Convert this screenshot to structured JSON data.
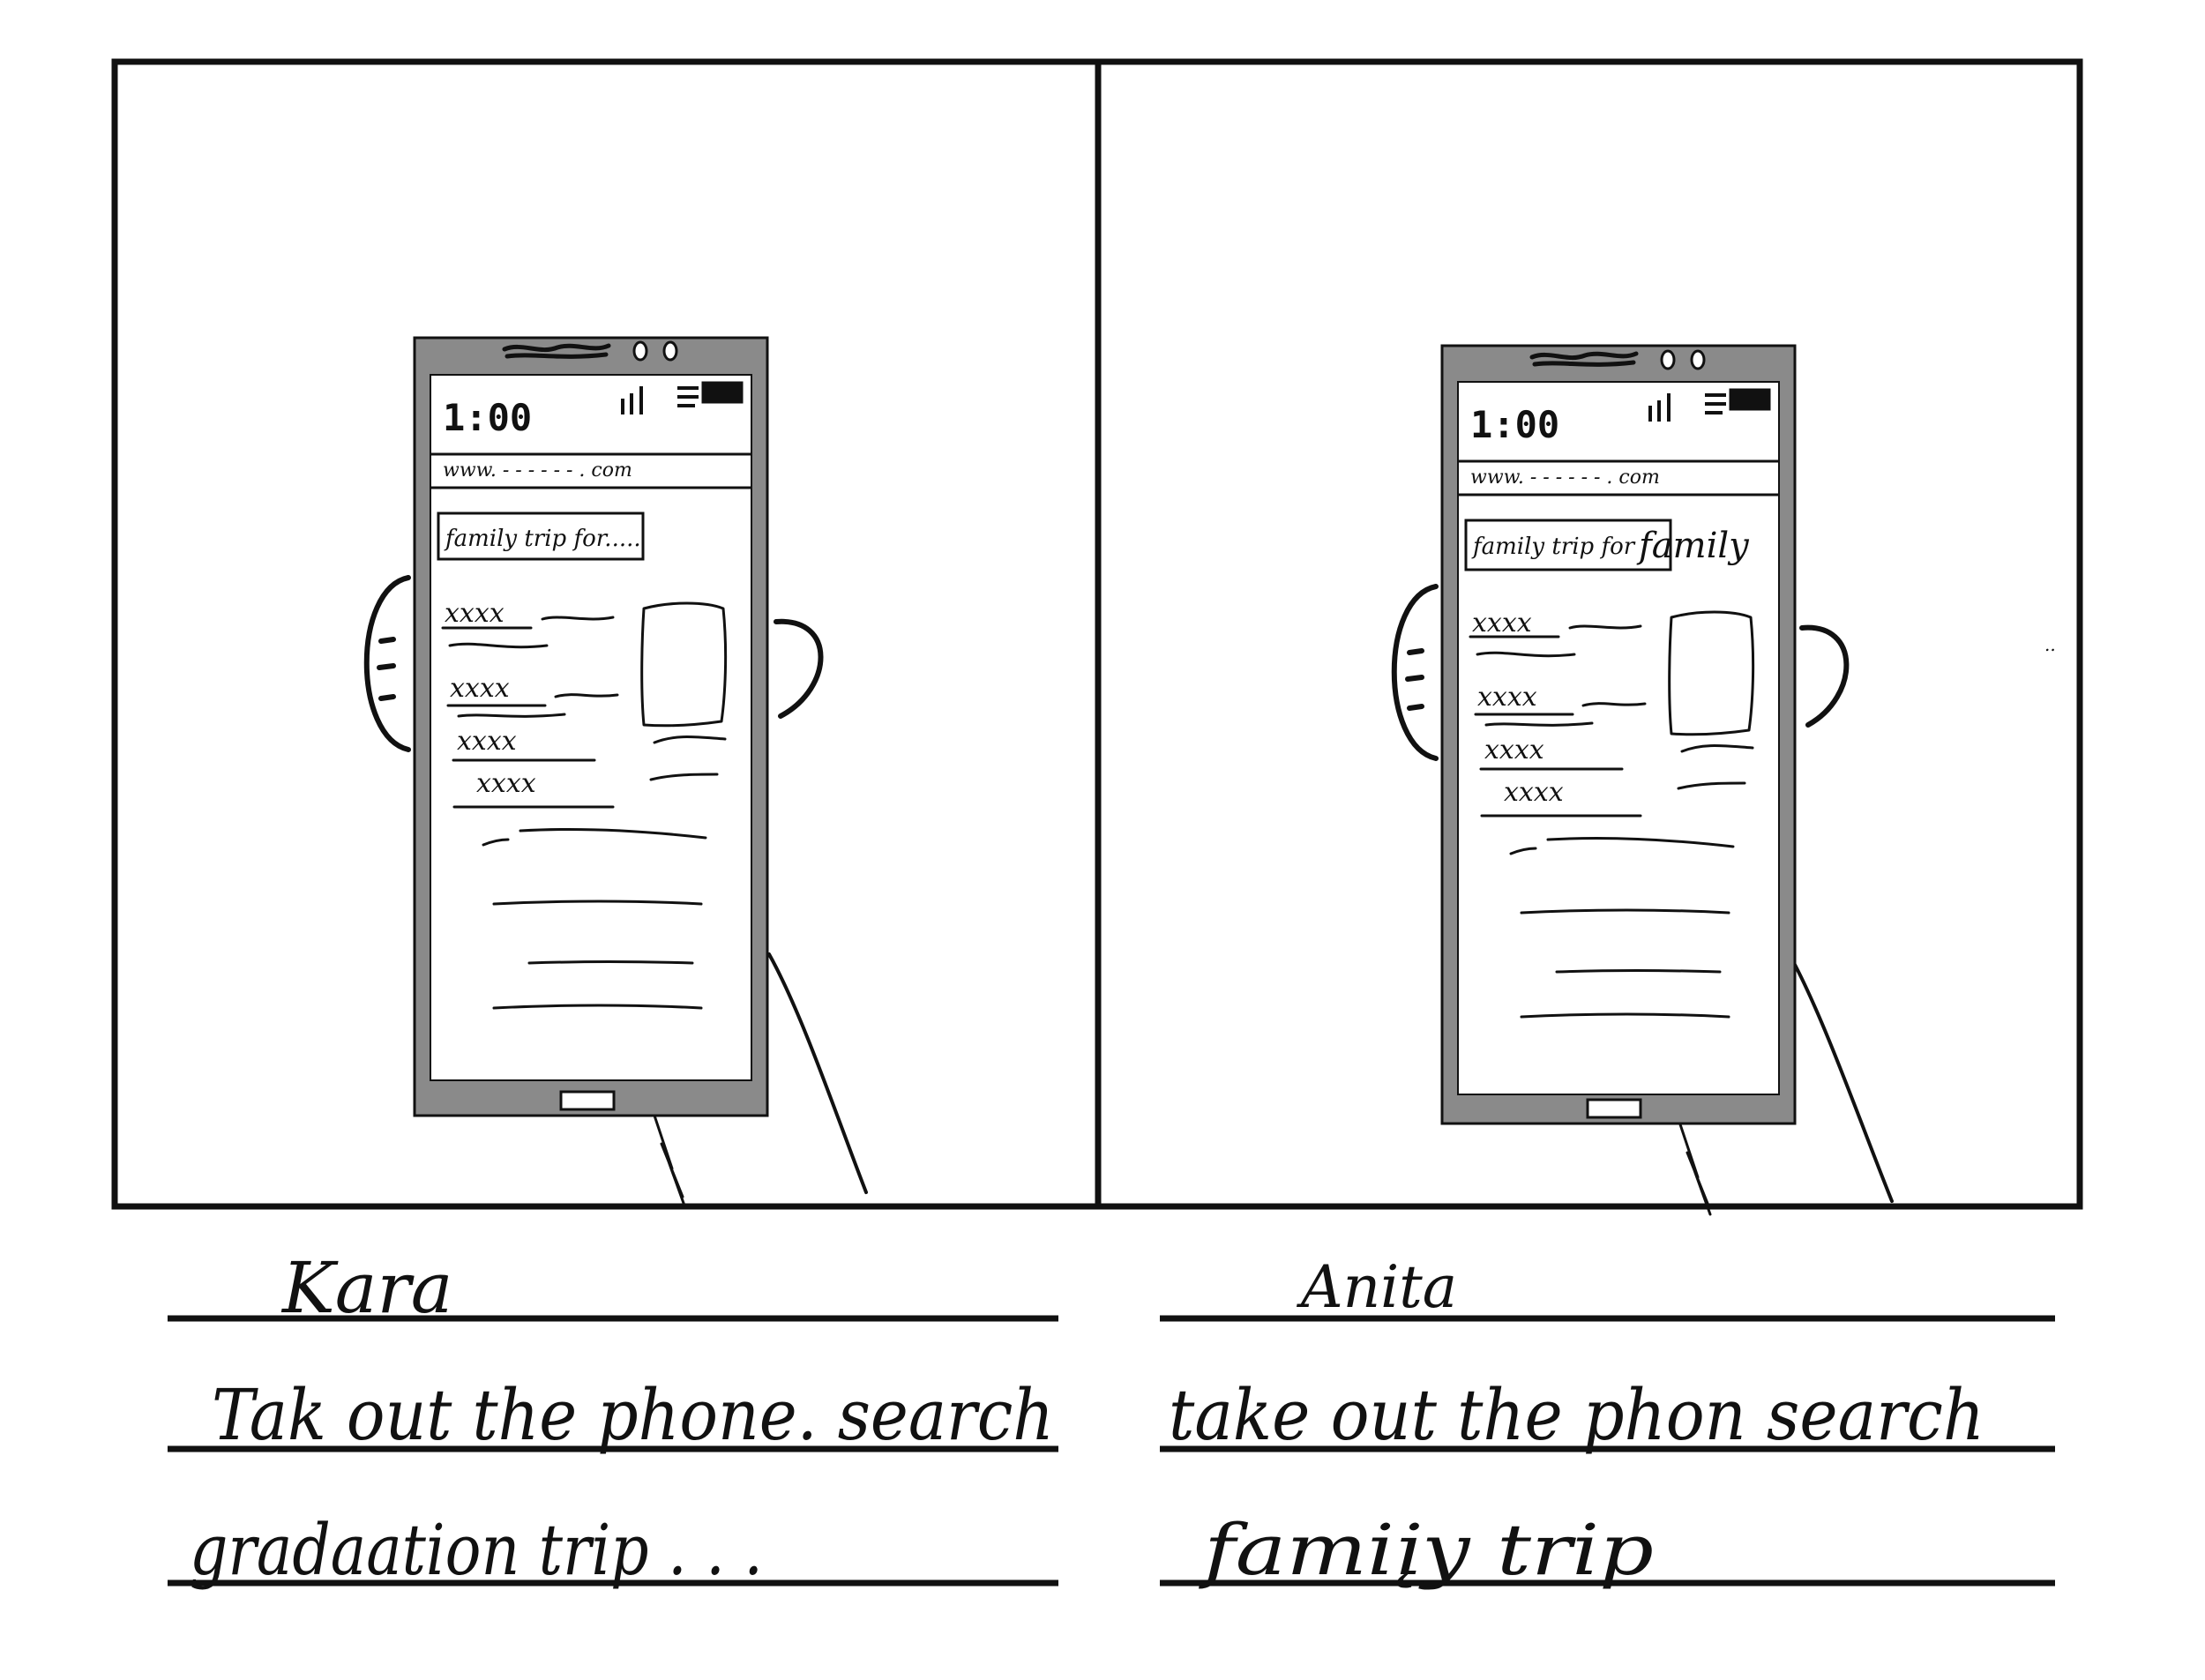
{
  "colors": {
    "ink": "#111111",
    "phone_body": "#8a8a8a",
    "screen": "#ffffff",
    "paper": "#ffffff"
  },
  "panels": [
    {
      "status_time": "1:00",
      "url": "www. - - - - - - . com",
      "search_text": "family trip for.....",
      "search_overflow": "",
      "result_marks": [
        "xxxx",
        "xxxx",
        "xxxx",
        "xxxx"
      ],
      "caption_lines": [
        "Kara",
        "Tak out the phone. search",
        "gradaation trip . . ."
      ]
    },
    {
      "status_time": "1:00",
      "url": "www. - - - - - - . com",
      "search_text": "family trip for",
      "search_overflow": "family",
      "result_marks": [
        "xxxx",
        "xxxx",
        "xxxx",
        "xxxx"
      ],
      "caption_lines": [
        "Anita",
        "take out the phon    search",
        "famiįy trip"
      ]
    }
  ]
}
